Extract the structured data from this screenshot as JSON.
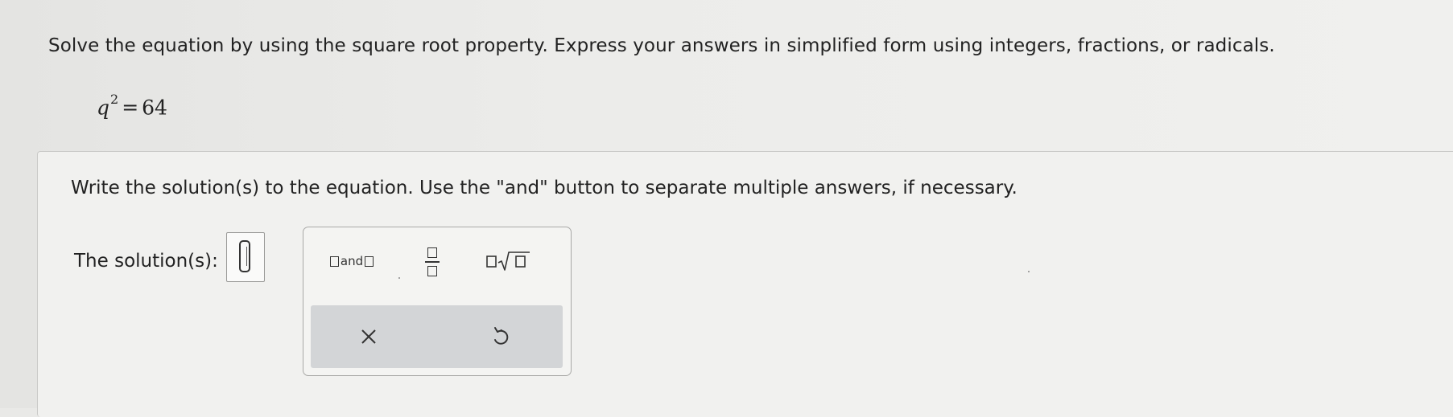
{
  "question": {
    "instructions": "Solve the equation by using the square root property. Express your answers in simplified form using integers, fractions, or radicals.",
    "equation": {
      "variable": "q",
      "exponent": "2",
      "operator": "=",
      "rhs": "64"
    }
  },
  "answer": {
    "prompt": "Write the solution(s) to the equation. Use the \"and\" button to separate multiple answers, if necessary.",
    "solution_label": "The solution(s):",
    "input_value": ""
  },
  "palette": {
    "and_label": "and",
    "icons": {
      "and": "and-template-icon",
      "fraction": "fraction-template-icon",
      "radical": "radical-template-icon",
      "clear": "clear-x-icon",
      "undo": "undo-icon"
    }
  },
  "colors": {
    "text": "#222222",
    "action_bar": "#d3d5d7",
    "panel_border": "#a9a9a7"
  }
}
